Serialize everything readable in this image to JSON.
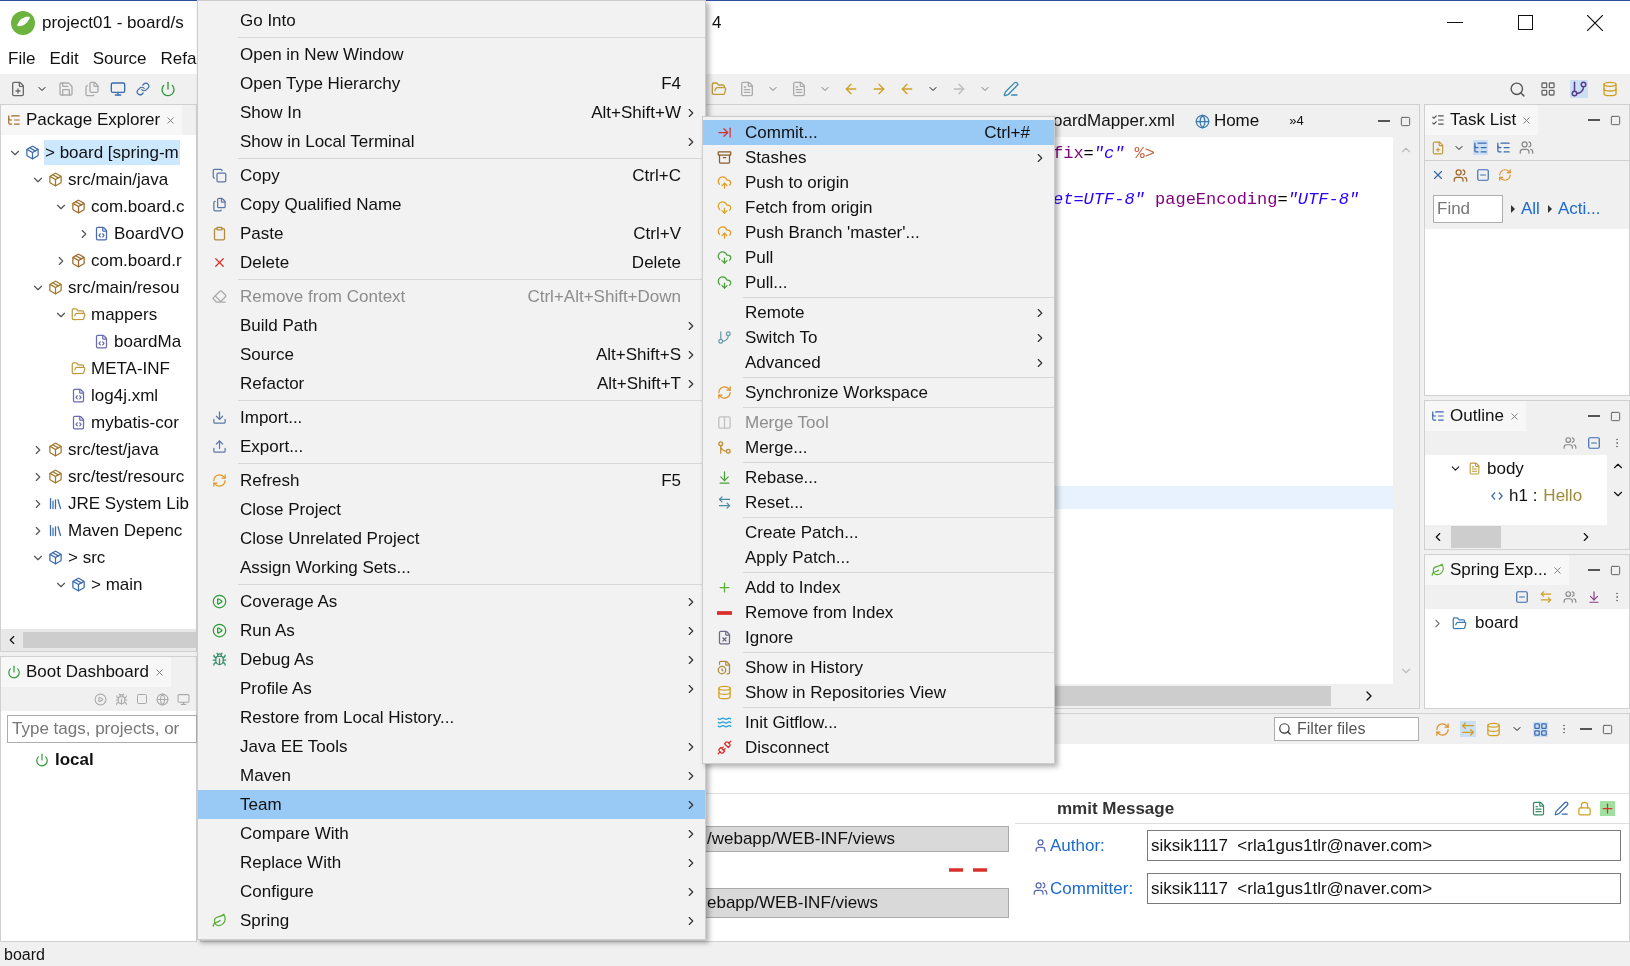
{
  "window": {
    "title": "project01 - board/s",
    "title_tail": "4"
  },
  "menubar": [
    "File",
    "Edit",
    "Source",
    "Refa"
  ],
  "package_explorer": {
    "title": "Package Explorer",
    "tree": [
      {
        "kind": "project",
        "label": "> board [spring-m",
        "expanded": true,
        "selected": true,
        "children": [
          {
            "kind": "source-folder",
            "label": "src/main/java",
            "expanded": true,
            "selected": false,
            "children": [
              {
                "kind": "package",
                "label": "com.board.c",
                "expanded": true,
                "selected": false,
                "children": [
                  {
                    "kind": "java-file",
                    "label": "BoardVO",
                    "expanded": false,
                    "selected": false
                  }
                ]
              },
              {
                "kind": "package",
                "label": "com.board.r",
                "expanded": false,
                "selected": false
              }
            ]
          },
          {
            "kind": "source-folder",
            "label": "src/main/resou",
            "expanded": true,
            "selected": false,
            "children": [
              {
                "kind": "folder",
                "label": "mappers",
                "expanded": true,
                "selected": false,
                "children": [
                  {
                    "kind": "xml-file",
                    "label": "boardMa",
                    "selected": false
                  }
                ]
              },
              {
                "kind": "folder",
                "label": "META-INF",
                "selected": false
              },
              {
                "kind": "xml-file",
                "label": "log4j.xml",
                "selected": false
              },
              {
                "kind": "xml-file",
                "label": "mybatis-cor",
                "selected": false
              }
            ]
          },
          {
            "kind": "source-folder",
            "label": "src/test/java",
            "expanded": false,
            "selected": false
          },
          {
            "kind": "source-folder",
            "label": "src/test/resourc",
            "expanded": false,
            "selected": false
          },
          {
            "kind": "library",
            "label": "JRE System Lib",
            "expanded": false,
            "selected": false
          },
          {
            "kind": "library",
            "label": "Maven Depenc",
            "expanded": false,
            "selected": false
          },
          {
            "kind": "project",
            "label": "> src",
            "expanded": true,
            "selected": false,
            "children": [
              {
                "kind": "project",
                "label": "> main",
                "expanded": true,
                "selected": false
              }
            ]
          }
        ]
      }
    ]
  },
  "boot_dashboard": {
    "title": "Boot Dashboard",
    "search": {
      "placeholder": "Type tags, projects, or"
    },
    "items": [
      {
        "label": "local"
      }
    ]
  },
  "editor": {
    "tabs": [
      {
        "label": "oardMapper.xml",
        "selected": false
      },
      {
        "label": "Home",
        "selected": false
      }
    ],
    "overflow": "»4",
    "lines": [
      {
        "current": false,
        "segments": [
          {
            "kind": "attr",
            "text": "fix"
          },
          {
            "kind": "op",
            "text": "="
          },
          {
            "kind": "string",
            "text": "\"c\""
          },
          {
            "kind": "directive",
            "text": " %>"
          }
        ]
      },
      {
        "current": false
      },
      {
        "current": false,
        "segments": [
          {
            "kind": "string",
            "text": "et=UTF-8\""
          },
          {
            "kind": "attr",
            "text": " pageEncoding"
          },
          {
            "kind": "op",
            "text": "="
          },
          {
            "kind": "string",
            "text": "\"UTF-8\""
          }
        ]
      },
      {
        "current": false
      },
      {
        "current": false
      },
      {
        "current": false
      },
      {
        "current": false
      },
      {
        "current": false
      },
      {
        "current": false
      },
      {
        "current": false
      },
      {
        "current": false
      },
      {
        "current": false
      },
      {
        "current": false
      },
      {
        "current": false
      },
      {
        "current": false
      },
      {
        "current": true
      }
    ]
  },
  "task_list": {
    "title": "Task List",
    "find": {
      "placeholder": "Find"
    },
    "links": [
      "All",
      "Acti..."
    ]
  },
  "outline": {
    "title": "Outline",
    "tree": [
      {
        "label": "body",
        "expanded": true,
        "children": [
          {
            "label": "h1 :",
            "detail": "Hello"
          }
        ]
      }
    ]
  },
  "spring_explorer": {
    "title": "Spring Exp...",
    "tree": [
      {
        "label": "board",
        "expanded": false
      }
    ]
  },
  "staging": {
    "filter": {
      "placeholder": "Filter files"
    },
    "paths": [
      "/webapp/WEB-INF/views",
      "ebapp/WEB-INF/views"
    ],
    "commit_title": "mmit Message",
    "fields": [
      {
        "label": "Author:",
        "value": "siksik1117  <rla1gus1tlr@naver.com>"
      },
      {
        "label": "Committer:",
        "value": "siksik1117  <rla1gus1tlr@naver.com>"
      }
    ]
  },
  "status_bar": {
    "text": "board"
  },
  "context_menu": {
    "groups": [
      [
        {
          "label": "Go Into",
          "selected": false,
          "disabled": false,
          "submenu": false
        }
      ],
      [
        {
          "label": "Open in New Window",
          "selected": false,
          "disabled": false,
          "submenu": false
        },
        {
          "label": "Open Type Hierarchy",
          "shortcut": "F4",
          "selected": false,
          "disabled": false,
          "submenu": false
        },
        {
          "label": "Show In",
          "shortcut": "Alt+Shift+W",
          "selected": false,
          "disabled": false,
          "submenu": true
        },
        {
          "label": "Show in Local Terminal",
          "selected": false,
          "disabled": false,
          "submenu": true
        }
      ],
      [
        {
          "label": "Copy",
          "shortcut": "Ctrl+C",
          "kind": "copy",
          "selected": false,
          "disabled": false,
          "submenu": false
        },
        {
          "label": "Copy Qualified Name",
          "kind": "copyname",
          "selected": false,
          "disabled": false,
          "submenu": false
        },
        {
          "label": "Paste",
          "shortcut": "Ctrl+V",
          "kind": "paste",
          "selected": false,
          "disabled": false,
          "submenu": false
        },
        {
          "label": "Delete",
          "shortcut": "Delete",
          "kind": "delete",
          "selected": false,
          "disabled": false,
          "submenu": false
        }
      ],
      [
        {
          "label": "Remove from Context",
          "shortcut": "Ctrl+Alt+Shift+Down",
          "kind": "remove",
          "selected": false,
          "disabled": true,
          "submenu": false
        },
        {
          "label": "Build Path",
          "selected": false,
          "disabled": false,
          "submenu": true
        },
        {
          "label": "Source",
          "shortcut": "Alt+Shift+S",
          "selected": false,
          "disabled": false,
          "submenu": true
        },
        {
          "label": "Refactor",
          "shortcut": "Alt+Shift+T",
          "selected": false,
          "disabled": false,
          "submenu": true
        }
      ],
      [
        {
          "label": "Import...",
          "kind": "import",
          "selected": false,
          "disabled": false,
          "submenu": false
        },
        {
          "label": "Export...",
          "kind": "export",
          "selected": false,
          "disabled": false,
          "submenu": false
        }
      ],
      [
        {
          "label": "Refresh",
          "shortcut": "F5",
          "kind": "refresh",
          "selected": false,
          "disabled": false,
          "submenu": false
        },
        {
          "label": "Close Project",
          "selected": false,
          "disabled": false,
          "submenu": false
        },
        {
          "label": "Close Unrelated Project",
          "selected": false,
          "disabled": false,
          "submenu": false
        },
        {
          "label": "Assign Working Sets...",
          "selected": false,
          "disabled": false,
          "submenu": false
        }
      ],
      [
        {
          "label": "Coverage As",
          "kind": "coverage",
          "selected": false,
          "disabled": false,
          "submenu": true
        },
        {
          "label": "Run As",
          "kind": "run",
          "selected": false,
          "disabled": false,
          "submenu": true
        },
        {
          "label": "Debug As",
          "kind": "debug",
          "selected": false,
          "disabled": false,
          "submenu": true
        },
        {
          "label": "Profile As",
          "selected": false,
          "disabled": false,
          "submenu": true
        },
        {
          "label": "Restore from Local History...",
          "selected": false,
          "disabled": false,
          "submenu": false
        },
        {
          "label": "Java EE Tools",
          "selected": false,
          "disabled": false,
          "submenu": true
        },
        {
          "label": "Maven",
          "selected": false,
          "disabled": false,
          "submenu": true
        },
        {
          "label": "Team",
          "selected": true,
          "disabled": false,
          "submenu": true
        },
        {
          "label": "Compare With",
          "selected": false,
          "disabled": false,
          "submenu": true
        },
        {
          "label": "Replace With",
          "selected": false,
          "disabled": false,
          "submenu": true
        },
        {
          "label": "Configure",
          "selected": false,
          "disabled": false,
          "submenu": true
        },
        {
          "label": "Spring",
          "kind": "spring",
          "selected": false,
          "disabled": false,
          "submenu": true
        }
      ]
    ]
  },
  "team_menu": {
    "groups": [
      [
        {
          "label": "Commit...",
          "shortcut": "Ctrl+#",
          "kind": "commit",
          "selected": true,
          "disabled": false,
          "submenu": false
        },
        {
          "label": "Stashes",
          "kind": "stash",
          "selected": false,
          "disabled": false,
          "submenu": true
        },
        {
          "label": "Push to origin",
          "kind": "push",
          "selected": false,
          "disabled": false,
          "submenu": false
        },
        {
          "label": "Fetch from origin",
          "kind": "fetch",
          "selected": false,
          "disabled": false,
          "submenu": false
        },
        {
          "label": "Push Branch 'master'...",
          "kind": "push",
          "selected": false,
          "disabled": false,
          "submenu": false
        },
        {
          "label": "Pull",
          "kind": "pull",
          "selected": false,
          "disabled": false,
          "submenu": false
        },
        {
          "label": "Pull...",
          "kind": "pull",
          "selected": false,
          "disabled": false,
          "submenu": false
        }
      ],
      [
        {
          "label": "Remote",
          "selected": false,
          "disabled": false,
          "submenu": true
        },
        {
          "label": "Switch To",
          "kind": "switch",
          "selected": false,
          "disabled": false,
          "submenu": true
        },
        {
          "label": "Advanced",
          "selected": false,
          "disabled": false,
          "submenu": true
        }
      ],
      [
        {
          "label": "Synchronize Workspace",
          "kind": "sync",
          "selected": false,
          "disabled": false,
          "submenu": false
        }
      ],
      [
        {
          "label": "Merge Tool",
          "kind": "mergetool",
          "selected": false,
          "disabled": true,
          "submenu": false
        },
        {
          "label": "Merge...",
          "kind": "merge",
          "selected": false,
          "disabled": false,
          "submenu": false
        }
      ],
      [
        {
          "label": "Rebase...",
          "kind": "rebase",
          "selected": false,
          "disabled": false,
          "submenu": false
        },
        {
          "label": "Reset...",
          "kind": "reset",
          "selected": false,
          "disabled": false,
          "submenu": false
        }
      ],
      [
        {
          "label": "Create Patch...",
          "selected": false,
          "disabled": false,
          "submenu": false
        },
        {
          "label": "Apply Patch...",
          "selected": false,
          "disabled": false,
          "submenu": false
        }
      ],
      [
        {
          "label": "Add to Index",
          "kind": "add",
          "selected": false,
          "disabled": false,
          "submenu": false
        },
        {
          "label": "Remove from Index",
          "kind": "removeidx",
          "selected": false,
          "disabled": false,
          "submenu": false
        },
        {
          "label": "Ignore",
          "kind": "ignore",
          "selected": false,
          "disabled": false,
          "submenu": false
        }
      ],
      [
        {
          "label": "Show in History",
          "kind": "history",
          "selected": false,
          "disabled": false,
          "submenu": false
        },
        {
          "label": "Show in Repositories View",
          "kind": "repo",
          "selected": false,
          "disabled": false,
          "submenu": false
        }
      ],
      [
        {
          "label": "Init Gitflow...",
          "kind": "gitflow",
          "selected": false,
          "disabled": false,
          "submenu": false
        },
        {
          "label": "Disconnect",
          "kind": "disconnect",
          "selected": false,
          "disabled": false,
          "submenu": false
        }
      ]
    ]
  }
}
